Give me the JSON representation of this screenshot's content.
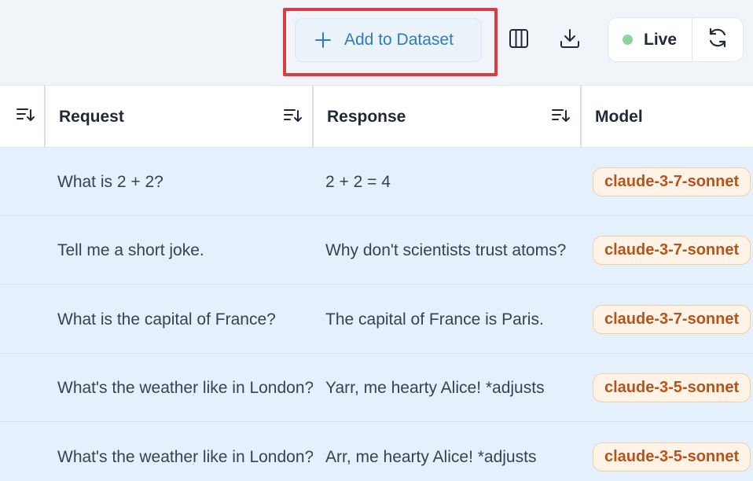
{
  "toolbar": {
    "add_to_dataset_label": "Add to Dataset",
    "live_label": "Live",
    "live_dot_color": "#8fd39a",
    "highlight_color": "#dc3b41"
  },
  "table": {
    "columns": [
      {
        "label": ""
      },
      {
        "label": "Request"
      },
      {
        "label": "Response"
      },
      {
        "label": "Model"
      }
    ],
    "rows": [
      {
        "request": "What is 2 + 2?",
        "response": "2 + 2 = 4",
        "model": "claude-3-7-sonnet"
      },
      {
        "request": "Tell me a short joke.",
        "response": "Why don't scientists trust atoms?",
        "model": "claude-3-7-sonnet"
      },
      {
        "request": "What is the capital of France?",
        "response": "The capital of France is Paris.",
        "model": "claude-3-7-sonnet"
      },
      {
        "request": "What's the weather like in London?",
        "response": "Yarr, me hearty Alice! *adjusts",
        "model": "claude-3-5-sonnet"
      },
      {
        "request": "What's the weather like in London?",
        "response": "Arr, me hearty Alice! *adjusts",
        "model": "claude-3-5-sonnet"
      }
    ]
  },
  "icons": {
    "add": "plus-icon",
    "columns": "columns-icon",
    "download": "download-icon",
    "refresh": "refresh-icon",
    "sort": "sort-icon"
  },
  "colors": {
    "row_background": "#e4f1fd",
    "badge_text": "#b5541a",
    "badge_background": "#fef3e6",
    "accent": "#2e7cb8"
  }
}
